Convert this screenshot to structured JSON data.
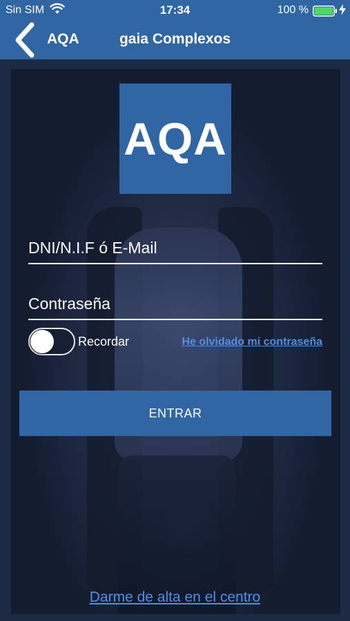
{
  "status_bar": {
    "carrier": "Sin SIM",
    "wifi_icon": "wifi-icon",
    "time": "17:34",
    "battery_percent": "100 %",
    "battery_icon": "battery-icon",
    "charging_icon": "bolt-icon",
    "battery_level": 1.0
  },
  "nav": {
    "back_icon": "chevron-left-icon",
    "back_label": "AQA",
    "title": "gaia Complexos"
  },
  "logo": {
    "text": "AQA"
  },
  "form": {
    "username_placeholder": "DNI/N.I.F ó E-Mail",
    "password_placeholder": "Contraseña",
    "remember_label": "Recordar",
    "remember_on": false,
    "forgot_link": "He olvidado mi contraseña",
    "submit_label": "ENTRAR"
  },
  "footer": {
    "signup_link": "Darme de alta en el centro"
  },
  "colors": {
    "primary": "#2f66a3",
    "link": "#4f8fe8",
    "background": "#1d2a44",
    "battery": "#4cd964"
  }
}
